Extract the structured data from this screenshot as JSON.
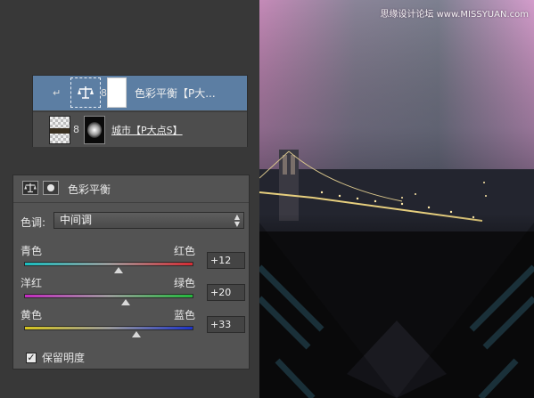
{
  "layers": [
    {
      "name": "色彩平衡【P大...",
      "type": "adjustment",
      "selected": true,
      "icon": "balance-scale-icon"
    },
    {
      "name": "城市【P大点S】",
      "type": "image",
      "selected": false
    }
  ],
  "properties": {
    "title": "色彩平衡",
    "tone_label": "色调:",
    "tone_value": "中间调",
    "sliders": [
      {
        "left": "青色",
        "right": "红色",
        "value": "+12",
        "position": 0.56,
        "gradient": [
          "#19bfc0",
          "#d62b33"
        ]
      },
      {
        "left": "洋红",
        "right": "绿色",
        "value": "+20",
        "position": 0.6,
        "gradient": [
          "#c42cc1",
          "#22b93c"
        ]
      },
      {
        "left": "黄色",
        "right": "蓝色",
        "value": "+33",
        "position": 0.665,
        "gradient": [
          "#d6c51e",
          "#1c32c8"
        ]
      }
    ],
    "preserve_label": "保留明度",
    "preserve_checked": true
  },
  "canvas": {
    "watermark": "思缘设计论坛 www.MISSYUAN.com"
  },
  "colors": {
    "selected_layer": "#5c7ea3",
    "panel": "#535353",
    "background": "#383838"
  }
}
